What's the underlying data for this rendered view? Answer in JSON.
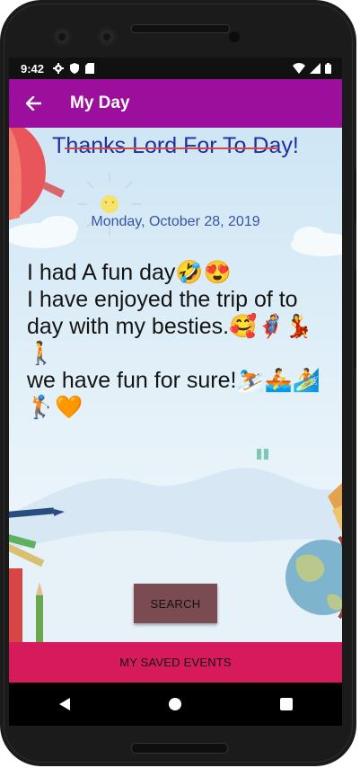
{
  "status_bar": {
    "time": "9:42",
    "left_icons": [
      "gear-icon",
      "shield-icon",
      "sim-icon"
    ],
    "right_icons": [
      "wifi-icon",
      "signal-icon",
      "battery-icon"
    ]
  },
  "app_bar": {
    "title": "My Day",
    "background": "#9c0f9c"
  },
  "content": {
    "headline": "Thanks Lord For To Day!",
    "date": "Monday, October 28, 2019",
    "note": "I had A fun day🤣😍\nI have enjoyed the trip of to day with my besties.🥰🦸💃🚶\nwe have fun for sure!⛷️🚣🏄🏌️🧡",
    "search_label": "SEARCH"
  },
  "bottom_bar": {
    "label": "MY SAVED EVENTS",
    "background": "#d61a5c"
  },
  "nav_bar": {
    "buttons": [
      "back-triangle-icon",
      "home-circle-icon",
      "recents-square-icon"
    ]
  }
}
